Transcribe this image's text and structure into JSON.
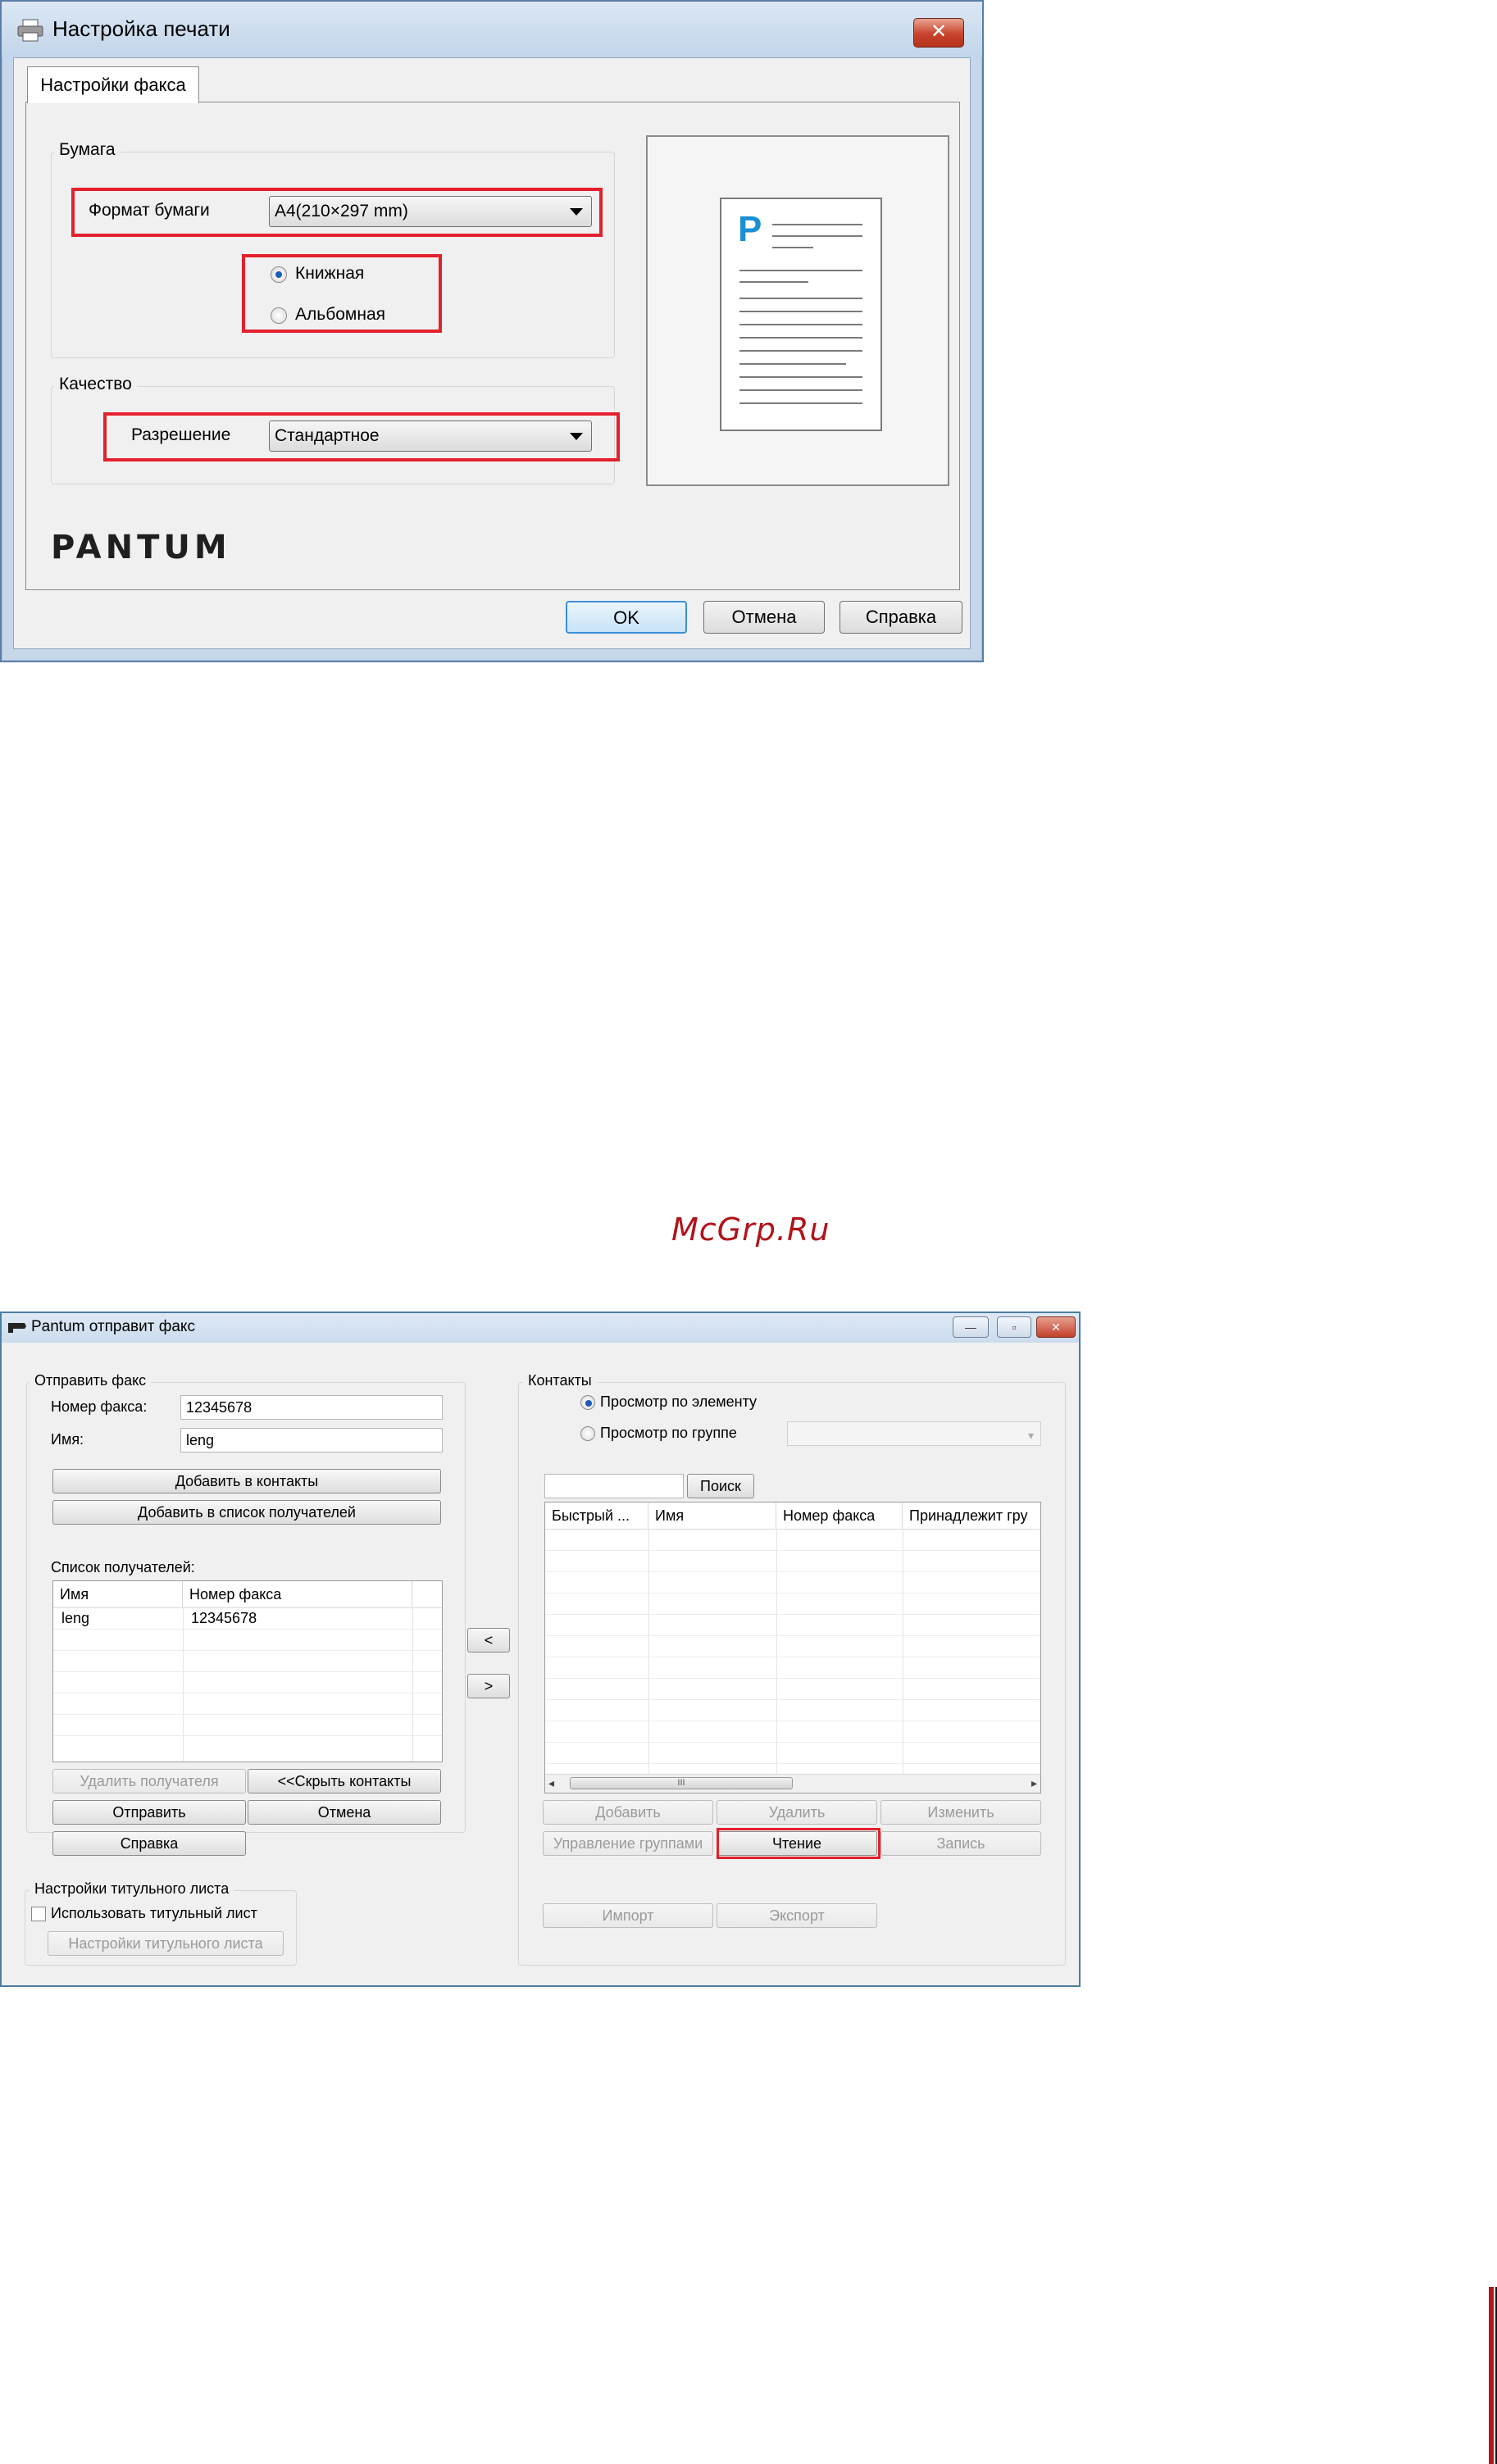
{
  "print_dialog": {
    "title": "Настройка печати",
    "close_glyph": "✕",
    "tab": "Настройки факса",
    "paper_group": "Бумага",
    "paper_size_label": "Формат бумаги",
    "paper_size_value": "A4(210×297 mm)",
    "orientation_options": [
      "Книжная",
      "Альбомная"
    ],
    "orientation_selected": "Книжная",
    "quality_group": "Качество",
    "resolution_label": "Разрешение",
    "resolution_value": "Стандартное",
    "preview_letter": "P",
    "logo": "PANTUM",
    "buttons": {
      "ok": "OK",
      "cancel": "Отмена",
      "help": "Справка"
    },
    "highlight_color": "#e3202c"
  },
  "watermark": "McGrp.Ru",
  "fax_dialog": {
    "title": "Pantum отправит факс",
    "window_buttons": {
      "minimize": "—",
      "restore": "▫",
      "close": "✕"
    },
    "send_group": "Отправить факс",
    "fax_number_label": "Номер факса:",
    "fax_number_value": "12345678",
    "name_label": "Имя:",
    "name_value": "leng",
    "add_to_contacts": "Добавить в контакты",
    "add_to_recipients": "Добавить в список получателей",
    "recipients_label": "Список получателей:",
    "recipients_columns": [
      "Имя",
      "Номер факса"
    ],
    "recipients_rows": [
      {
        "name": "leng",
        "fax": "12345678"
      }
    ],
    "remove_recipient": "Удалить получателя",
    "hide_contacts": "<<Скрыть контакты",
    "send": "Отправить",
    "cancel": "Отмена",
    "help": "Справка",
    "cover_group": "Настройки титульного листа",
    "use_cover": "Использовать титульный лист",
    "cover_settings": "Настройки титульного листа",
    "move_left": "<",
    "move_right": ">",
    "contacts_group": "Контакты",
    "view_by_item": "Просмотр по элементу",
    "view_by_group": "Просмотр по группе",
    "view_selected": "Просмотр по элементу",
    "search_button": "Поиск",
    "contacts_columns": [
      "Быстрый ...",
      "Имя",
      "Номер факса",
      "Принадлежит гру"
    ],
    "scroll_thumb_glyph": "III",
    "add": "Добавить",
    "delete": "Удалить",
    "edit": "Изменить",
    "manage_groups": "Управление группами",
    "read": "Чтение",
    "write": "Запись",
    "import": "Импорт",
    "export": "Экспорт"
  }
}
